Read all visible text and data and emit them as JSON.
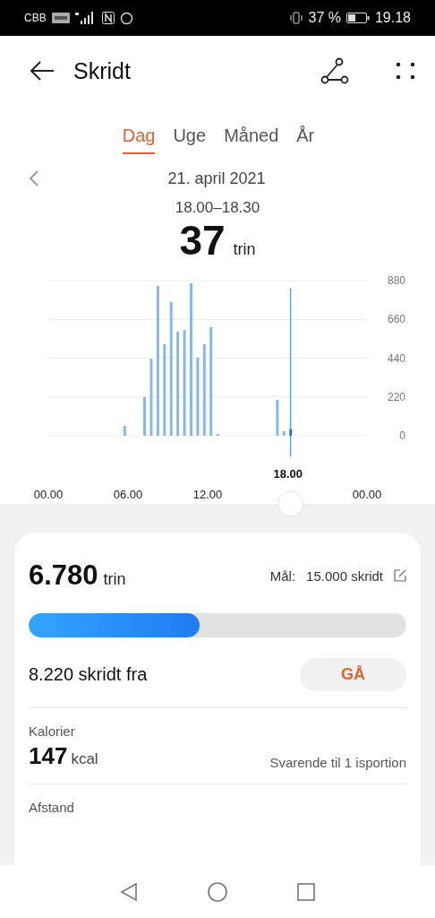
{
  "status_bar": {
    "carrier": "CBB",
    "battery": "37 %",
    "time": "19.18"
  },
  "header": {
    "title": "Skridt"
  },
  "tabs": [
    {
      "label": "Dag",
      "selected": true
    },
    {
      "label": "Uge",
      "selected": false
    },
    {
      "label": "Måned",
      "selected": false
    },
    {
      "label": "År",
      "selected": false
    }
  ],
  "date": "21. april 2021",
  "selection": {
    "range": "18.00–18.30",
    "value": "37",
    "unit": "trin"
  },
  "chart_data": {
    "type": "bar",
    "x": [
      5.75,
      7.25,
      7.75,
      8.25,
      8.75,
      9.25,
      9.75,
      10.25,
      10.75,
      11.25,
      11.75,
      12.25,
      12.75,
      17.25,
      17.75,
      18.25
    ],
    "values": [
      56,
      219,
      437,
      850,
      519,
      758,
      590,
      600,
      865,
      443,
      519,
      616,
      5,
      204,
      25,
      37
    ],
    "xlim": [
      0,
      24
    ],
    "ylim": [
      0,
      880
    ],
    "xticks": [
      {
        "value": 0,
        "label": "00.00"
      },
      {
        "value": 6,
        "label": "06.00"
      },
      {
        "value": 12,
        "label": "12.00"
      }
    ],
    "yticks": [
      0,
      220,
      440,
      660,
      880
    ],
    "grid": true,
    "ref_lines": [
      {
        "axis": "x",
        "value": 18.25
      }
    ]
  },
  "chart_selection_label": "18.00",
  "chart_end_label": "00.00",
  "summary": {
    "value": "6.780",
    "unit": "trin",
    "goal_label": "Mål:",
    "goal": "15.000 skridt",
    "level": 0.452,
    "remaining": "8.220 skridt fra",
    "go_button": "GÅ"
  },
  "metrics": [
    {
      "label": "Kalorier",
      "value": "147",
      "unit": "kcal",
      "note": "Svarende til 1 isportion"
    },
    {
      "label": "Afstand"
    }
  ]
}
